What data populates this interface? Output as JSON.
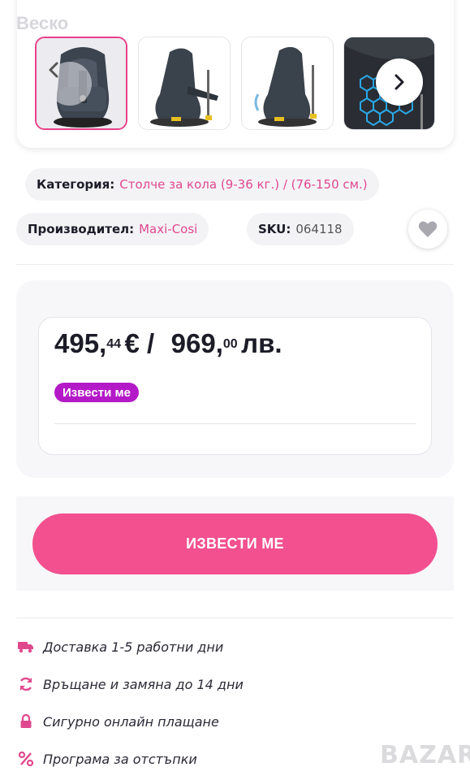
{
  "gallery": {
    "watermark": "Веско",
    "thumbnails": [
      {
        "name": "car-seat-front-view",
        "active": true
      },
      {
        "name": "car-seat-side-view",
        "active": false
      },
      {
        "name": "car-seat-recline-view",
        "active": false
      },
      {
        "name": "car-seat-fabric-closeup",
        "active": false
      }
    ]
  },
  "meta": {
    "category_label": "Категория:",
    "category_value": "Столче за кола (9-36 кг.) / (76-150 см.)",
    "brand_label": "Производител:",
    "brand_value": "Maxi-Cosi",
    "sku_label": "SKU:",
    "sku_value": "064118"
  },
  "price": {
    "eur_int": "495,",
    "eur_dec": "44",
    "eur_currency": "€ /",
    "bgn_int": "969,",
    "bgn_dec": "00",
    "bgn_currency": "лв.",
    "notify_badge": "Извести ме"
  },
  "cta": {
    "label": "ИЗВЕСТИ МЕ"
  },
  "features": [
    {
      "icon": "truck-icon",
      "text": "Доставка 1-5 работни дни"
    },
    {
      "icon": "refresh-icon",
      "text": "Връщане и замяна до 14 дни"
    },
    {
      "icon": "lock-icon",
      "text": "Сигурно онлайн плащане"
    },
    {
      "icon": "percent-icon",
      "text": "Програма за отстъпки"
    }
  ],
  "footer": {
    "logo_text": "BAZAR"
  },
  "colors": {
    "accent_pink": "#f2508f",
    "link_pink": "#e0488e",
    "badge_purple": "#b419c8"
  }
}
